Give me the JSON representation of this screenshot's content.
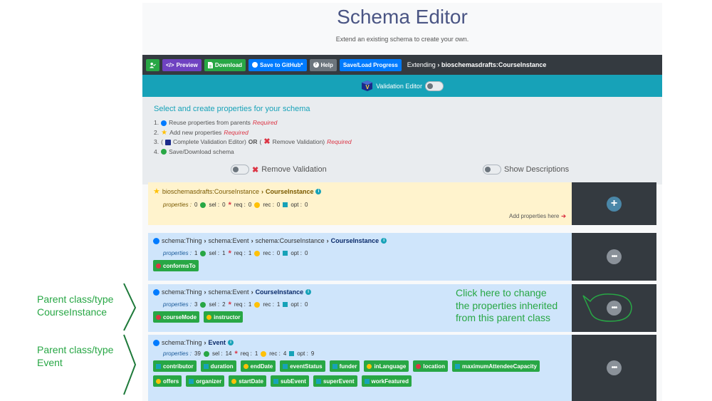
{
  "header": {
    "title": "Schema Editor",
    "subtitle": "Extend an existing schema to create your own."
  },
  "toolbar": {
    "preview": "Preview",
    "download": "Download",
    "github": "Save to GitHub*",
    "help": "Help",
    "save_load": "Save/Load Progress",
    "extending_label": "Extending",
    "extending_value": "bioschemasdrafts:CourseInstance"
  },
  "validation_bar": {
    "label": "Validation Editor"
  },
  "instructions": {
    "title": "Select and create properties for your schema",
    "steps": [
      {
        "num": "1.",
        "text": "Reuse properties from parents",
        "req": "Required"
      },
      {
        "num": "2.",
        "text": "Add new properties",
        "req": "Required"
      },
      {
        "num": "3.",
        "pre": "(",
        "mid": "Complete Validation Editor)",
        "or": "OR",
        "paren": "(",
        "post": "Remove Validation)",
        "req": "Required"
      },
      {
        "num": "4.",
        "text": "Save/Download schema"
      }
    ],
    "remove_validation": "Remove Validation",
    "show_descriptions": "Show Descriptions"
  },
  "cards": [
    {
      "crumbs": "bioschemasdrafts:CourseInstance",
      "cls": "CourseInstance",
      "stats": {
        "properties": "0",
        "sel": "0",
        "req": "0",
        "rec": "0",
        "opt": "0"
      },
      "add_props": "Add properties here"
    },
    {
      "crumbs": [
        "schema:Thing",
        "schema:Event",
        "schema:CourseInstance"
      ],
      "cls": "CourseInstance",
      "stats": {
        "properties": "1",
        "sel": "1",
        "req": "1",
        "rec": "0",
        "opt": "0"
      },
      "props": [
        {
          "name": "conformsTo",
          "kind": "star"
        }
      ]
    },
    {
      "crumbs": [
        "schema:Thing",
        "schema:Event"
      ],
      "cls": "CourseInstance",
      "stats": {
        "properties": "3",
        "sel": "2",
        "req": "1",
        "rec": "1",
        "opt": "0"
      },
      "props": [
        {
          "name": "courseMode",
          "kind": "star"
        },
        {
          "name": "instructor",
          "kind": "yellow"
        }
      ],
      "callout": [
        "Click here to change",
        "the properties inherited",
        "from this parent class"
      ]
    },
    {
      "crumbs": [
        "schema:Thing"
      ],
      "cls": "Event",
      "stats": {
        "properties": "39",
        "sel": "14",
        "req": "1",
        "rec": "4",
        "opt": "9"
      },
      "props": [
        {
          "name": "contributor",
          "kind": "teal"
        },
        {
          "name": "duration",
          "kind": "teal"
        },
        {
          "name": "endDate",
          "kind": "yellow"
        },
        {
          "name": "eventStatus",
          "kind": "teal"
        },
        {
          "name": "funder",
          "kind": "teal"
        },
        {
          "name": "inLanguage",
          "kind": "yellow"
        },
        {
          "name": "location",
          "kind": "star"
        },
        {
          "name": "maximumAttendeeCapacity",
          "kind": "teal"
        },
        {
          "name": "offers",
          "kind": "yellow"
        },
        {
          "name": "organizer",
          "kind": "teal"
        },
        {
          "name": "startDate",
          "kind": "yellow"
        },
        {
          "name": "subEvent",
          "kind": "teal"
        },
        {
          "name": "superEvent",
          "kind": "teal"
        },
        {
          "name": "workFeatured",
          "kind": "teal"
        }
      ]
    }
  ],
  "annotations": {
    "parent1": [
      "Parent class/type",
      "CourseInstance"
    ],
    "parent2": [
      "Parent class/type",
      "Event"
    ]
  },
  "stat_labels": {
    "properties": "properties :",
    "sel": "sel :",
    "req": "req :",
    "rec": "rec :",
    "opt": "opt :"
  },
  "colors": {
    "accent_teal": "#17a2b8",
    "success": "#28a745",
    "danger": "#dc3545",
    "dark": "#343a40"
  }
}
